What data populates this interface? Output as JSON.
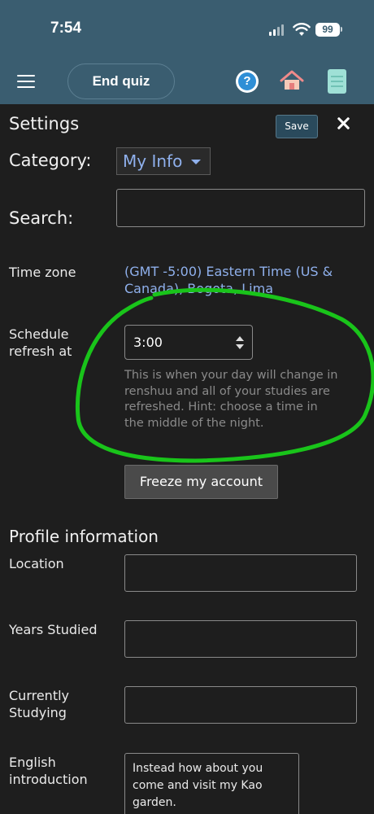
{
  "status_bar": {
    "time": "7:54",
    "battery": "99"
  },
  "app_bar": {
    "end_quiz_label": "End quiz",
    "menu_icon": "hamburger-icon",
    "help_icon": "question-icon",
    "home_icon": "house-icon",
    "book_icon": "notebook-icon"
  },
  "settings": {
    "title": "Settings",
    "save_label": "Save",
    "close_icon": "close-icon",
    "category_label": "Category:",
    "category_value": "My Info",
    "search_label": "Search:",
    "search_value": "",
    "time_zone_label": "Time zone",
    "time_zone_value": "(GMT -5:00) Eastern Time (US & Canada), Bogota, Lima",
    "schedule_label": "Schedule refresh at",
    "schedule_value": "3:00",
    "schedule_hint": "This is when your day will change in renshuu and all of your studies are refreshed. Hint: choose a time in the middle of the night.",
    "freeze_label": "Freeze my account"
  },
  "profile": {
    "section_title": "Profile information",
    "location_label": "Location",
    "location_value": "",
    "years_label": "Years Studied",
    "years_value": "",
    "currently_label": "Currently Studying",
    "currently_value": "",
    "intro_label": "English introduction",
    "intro_value": "Instead how about you come and visit my Kao garden.\n\nTHANK YOU TO EVERYONE"
  },
  "colors": {
    "header_bg": "#3a5d70",
    "panel_bg": "#1e1e1e",
    "link": "#8fb0ec",
    "annotation_stroke": "#19c41a"
  }
}
